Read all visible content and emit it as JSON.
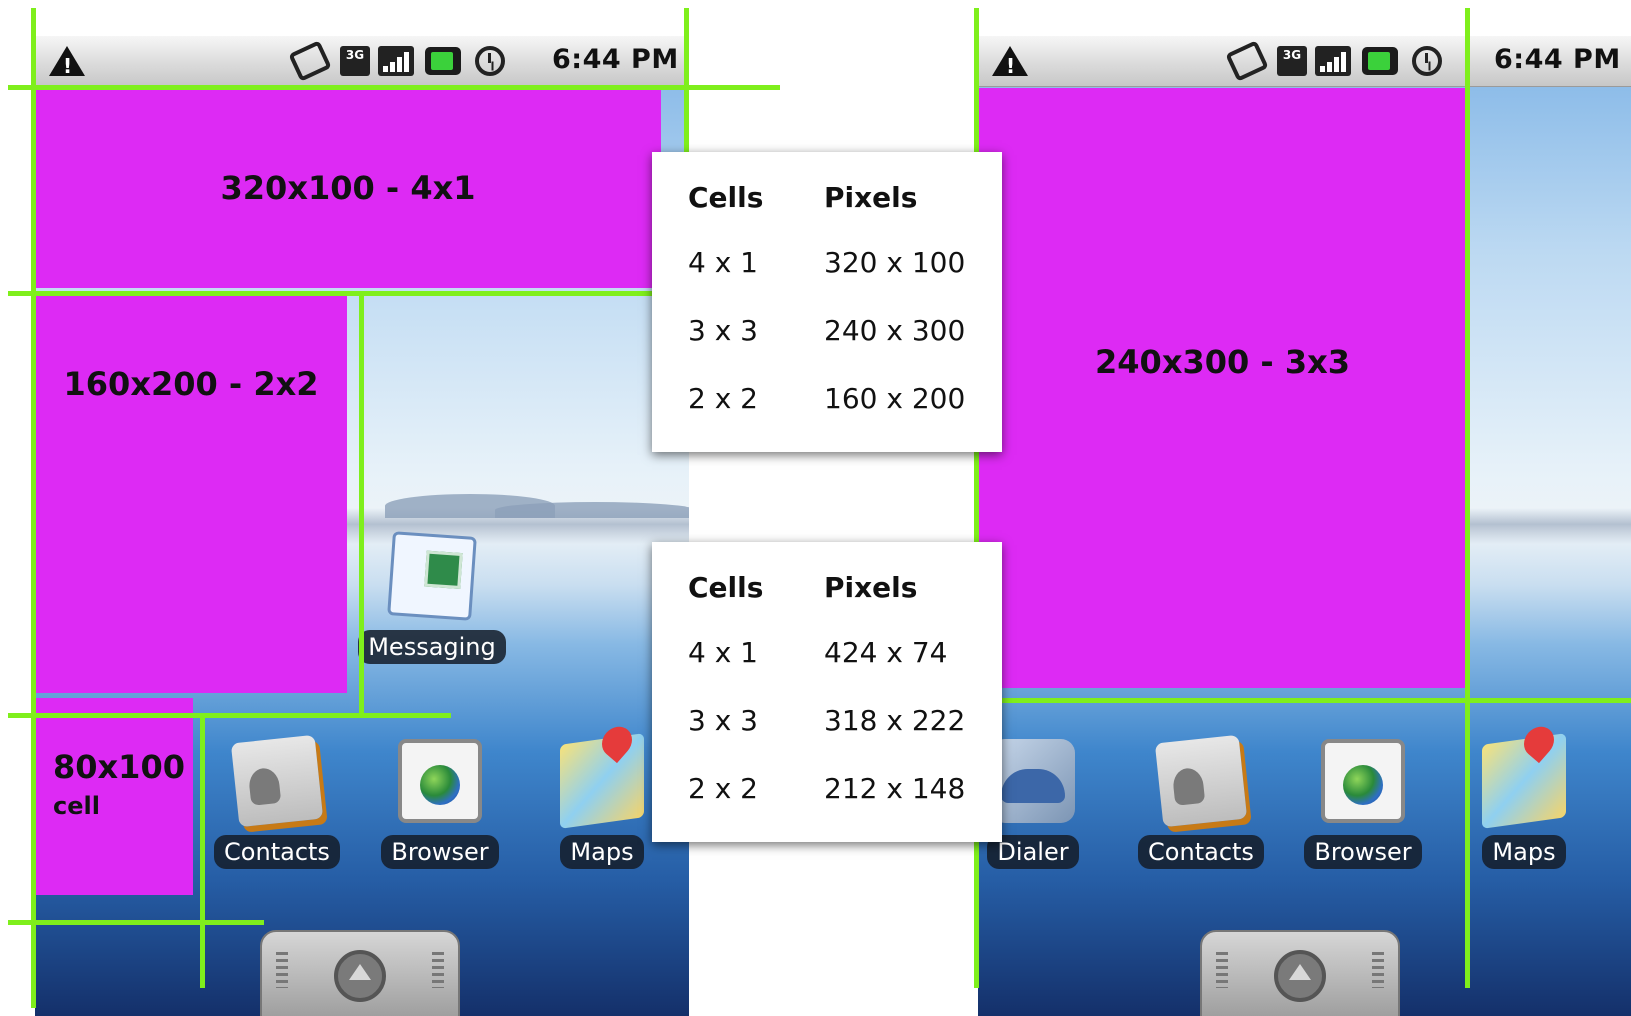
{
  "status_bar": {
    "time": "6:44 PM"
  },
  "left_screen": {
    "widgets": [
      {
        "label": "320x100 - 4x1"
      },
      {
        "label": "160x200 - 2x2"
      },
      {
        "label": "80x100",
        "sublabel": "cell"
      }
    ],
    "apps": [
      {
        "label": "Messaging",
        "icon": "messaging-icon"
      },
      {
        "label": "Contacts",
        "icon": "contacts-icon"
      },
      {
        "label": "Browser",
        "icon": "browser-icon"
      },
      {
        "label": "Maps",
        "icon": "maps-icon"
      }
    ]
  },
  "right_screen": {
    "widgets": [
      {
        "label": "240x300 - 3x3"
      }
    ],
    "apps": [
      {
        "label": "Dialer",
        "icon": "dialer-icon"
      },
      {
        "label": "Contacts",
        "icon": "contacts-icon"
      },
      {
        "label": "Browser",
        "icon": "browser-icon"
      },
      {
        "label": "Maps",
        "icon": "maps-icon"
      }
    ]
  },
  "tables": [
    {
      "headers": [
        "Cells",
        "Pixels"
      ],
      "rows": [
        [
          "4 x 1",
          "320 x 100"
        ],
        [
          "3 x 3",
          "240 x 300"
        ],
        [
          "2 x 2",
          "160 x 200"
        ]
      ]
    },
    {
      "headers": [
        "Cells",
        "Pixels"
      ],
      "rows": [
        [
          "4 x 1",
          "424 x 74"
        ],
        [
          "3 x 3",
          "318 x 222"
        ],
        [
          "2 x 2",
          "212 x 148"
        ]
      ]
    }
  ],
  "colors": {
    "widget": "#dd2af4",
    "gridline": "#7fef1c"
  }
}
